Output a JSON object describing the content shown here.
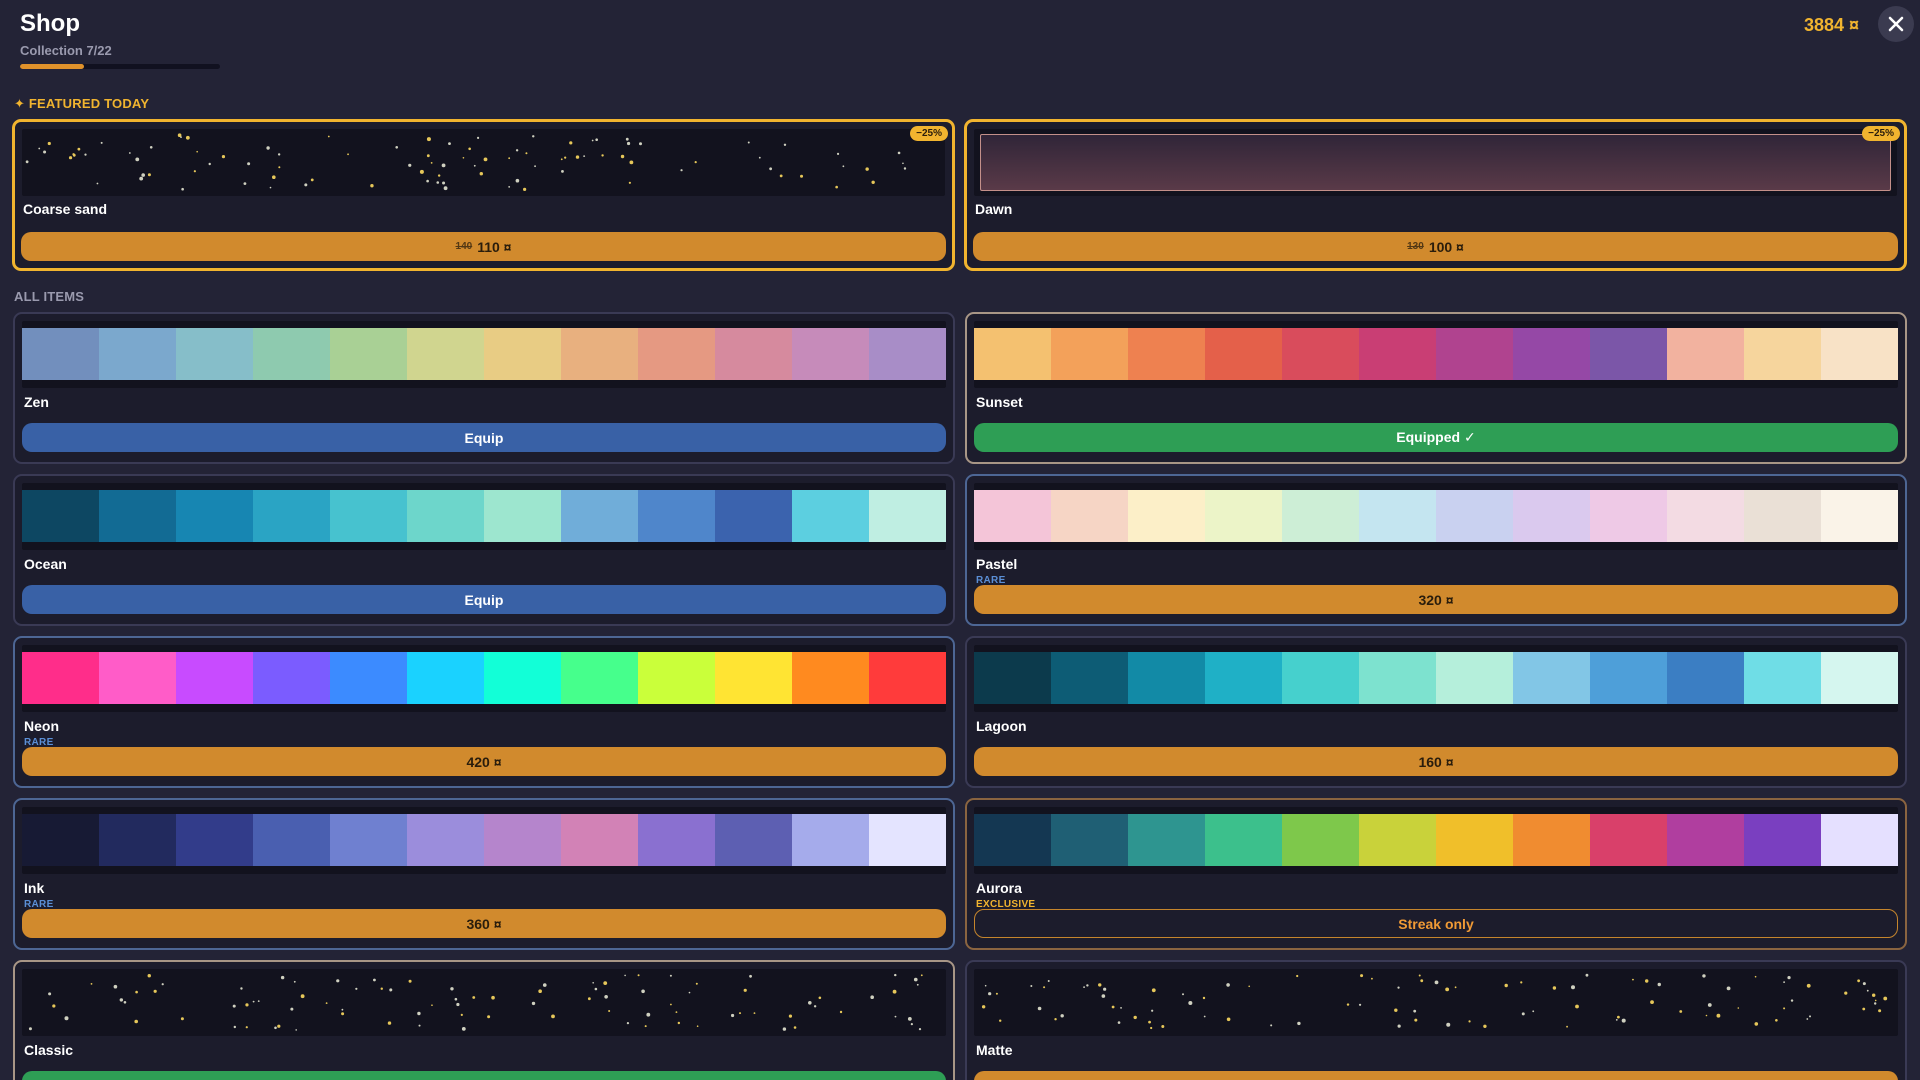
{
  "header": {
    "title": "Shop",
    "collection": "Collection 7/22",
    "collection_progress": 0.318,
    "coins": "3884 ¤"
  },
  "icons": {
    "close": "close-icon"
  },
  "featured": {
    "label": "✦ FEATURED TODAY",
    "items": [
      {
        "name": "Coarse sand",
        "badge": "−25%",
        "old_price": "140",
        "price": "110 ¤",
        "preview": "speckle"
      },
      {
        "name": "Dawn",
        "badge": "−25%",
        "old_price": "130",
        "price": "100 ¤",
        "preview": "gradient"
      }
    ]
  },
  "all_items": {
    "label": "ALL ITEMS",
    "items": [
      {
        "name": "Zen",
        "rarity": "",
        "button": "Equip",
        "state": "equip",
        "colors": [
          "#728fbd",
          "#7ba8cd",
          "#86bec9",
          "#8ecaaf",
          "#a9d095",
          "#d0d58f",
          "#e8cc84",
          "#e8b07f",
          "#e59982",
          "#d68a9e",
          "#c68bba",
          "#a88dc7"
        ]
      },
      {
        "name": "Sunset",
        "rarity": "",
        "button": "Equipped ✓",
        "state": "equipped",
        "colors": [
          "#f4c170",
          "#f3a15a",
          "#ee8150",
          "#e4604a",
          "#d94c5c",
          "#c93e74",
          "#b0438f",
          "#9548a6",
          "#7b56a8",
          "#f2b29f",
          "#f6d59d",
          "#f8e2c6"
        ]
      },
      {
        "name": "Ocean",
        "rarity": "",
        "button": "Equip",
        "state": "equip",
        "colors": [
          "#0d4762",
          "#126b94",
          "#1786b2",
          "#2aa4c4",
          "#47c2cf",
          "#6dd6cb",
          "#9de6cf",
          "#70add9",
          "#4f86cb",
          "#3b63ae",
          "#5ccfe0",
          "#bfeee2"
        ]
      },
      {
        "name": "Pastel",
        "rarity": "RARE",
        "button": "320 ¤",
        "state": "buy",
        "colors": [
          "#f4c5d8",
          "#f6d5c5",
          "#fcefc8",
          "#ecf4c8",
          "#cdeed6",
          "#c4e5f0",
          "#c9d1f0",
          "#dac9ee",
          "#eec9e6",
          "#f3dbe3",
          "#eae0d6",
          "#faf3e8"
        ]
      },
      {
        "name": "Neon",
        "rarity": "RARE",
        "button": "420 ¤",
        "state": "buy",
        "colors": [
          "#ff2d8a",
          "#ff5cc8",
          "#c84bff",
          "#7b5cff",
          "#3c8bff",
          "#1ad2ff",
          "#12ffd7",
          "#46ff8c",
          "#caff3a",
          "#ffe433",
          "#ff8a1f",
          "#ff3b3b"
        ]
      },
      {
        "name": "Lagoon",
        "rarity": "",
        "button": "160 ¤",
        "state": "buy",
        "colors": [
          "#0c3a4c",
          "#0d5c75",
          "#128aa6",
          "#1fb0c6",
          "#46d0cd",
          "#7de2cf",
          "#b5efdb",
          "#82c6e6",
          "#4e9fd9",
          "#3b7ec3",
          "#6fdde6",
          "#d5f6ef"
        ]
      },
      {
        "name": "Ink",
        "rarity": "RARE",
        "button": "360 ¤",
        "state": "buy",
        "colors": [
          "#171a34",
          "#222a5e",
          "#323c8a",
          "#4a5fb0",
          "#6f80d0",
          "#9b8ddc",
          "#b585cc",
          "#d282b6",
          "#8a70d0",
          "#5d5fb2",
          "#a5abeb",
          "#e4e4ff"
        ]
      },
      {
        "name": "Aurora",
        "rarity": "EXCLUSIVE",
        "button": "Streak only",
        "state": "streak",
        "colors": [
          "#143752",
          "#1f5f74",
          "#2e9590",
          "#3cc08c",
          "#7ec84b",
          "#c9d23a",
          "#f0bf2a",
          "#f08c30",
          "#d9406a",
          "#b03e9f",
          "#7a3fc0",
          "#e5e0ff"
        ]
      },
      {
        "name": "Classic",
        "rarity": "",
        "button": "",
        "state": "equipped",
        "preview": "speckle"
      },
      {
        "name": "Matte",
        "rarity": "",
        "button": "",
        "state": "buy",
        "preview": "speckle"
      }
    ]
  }
}
